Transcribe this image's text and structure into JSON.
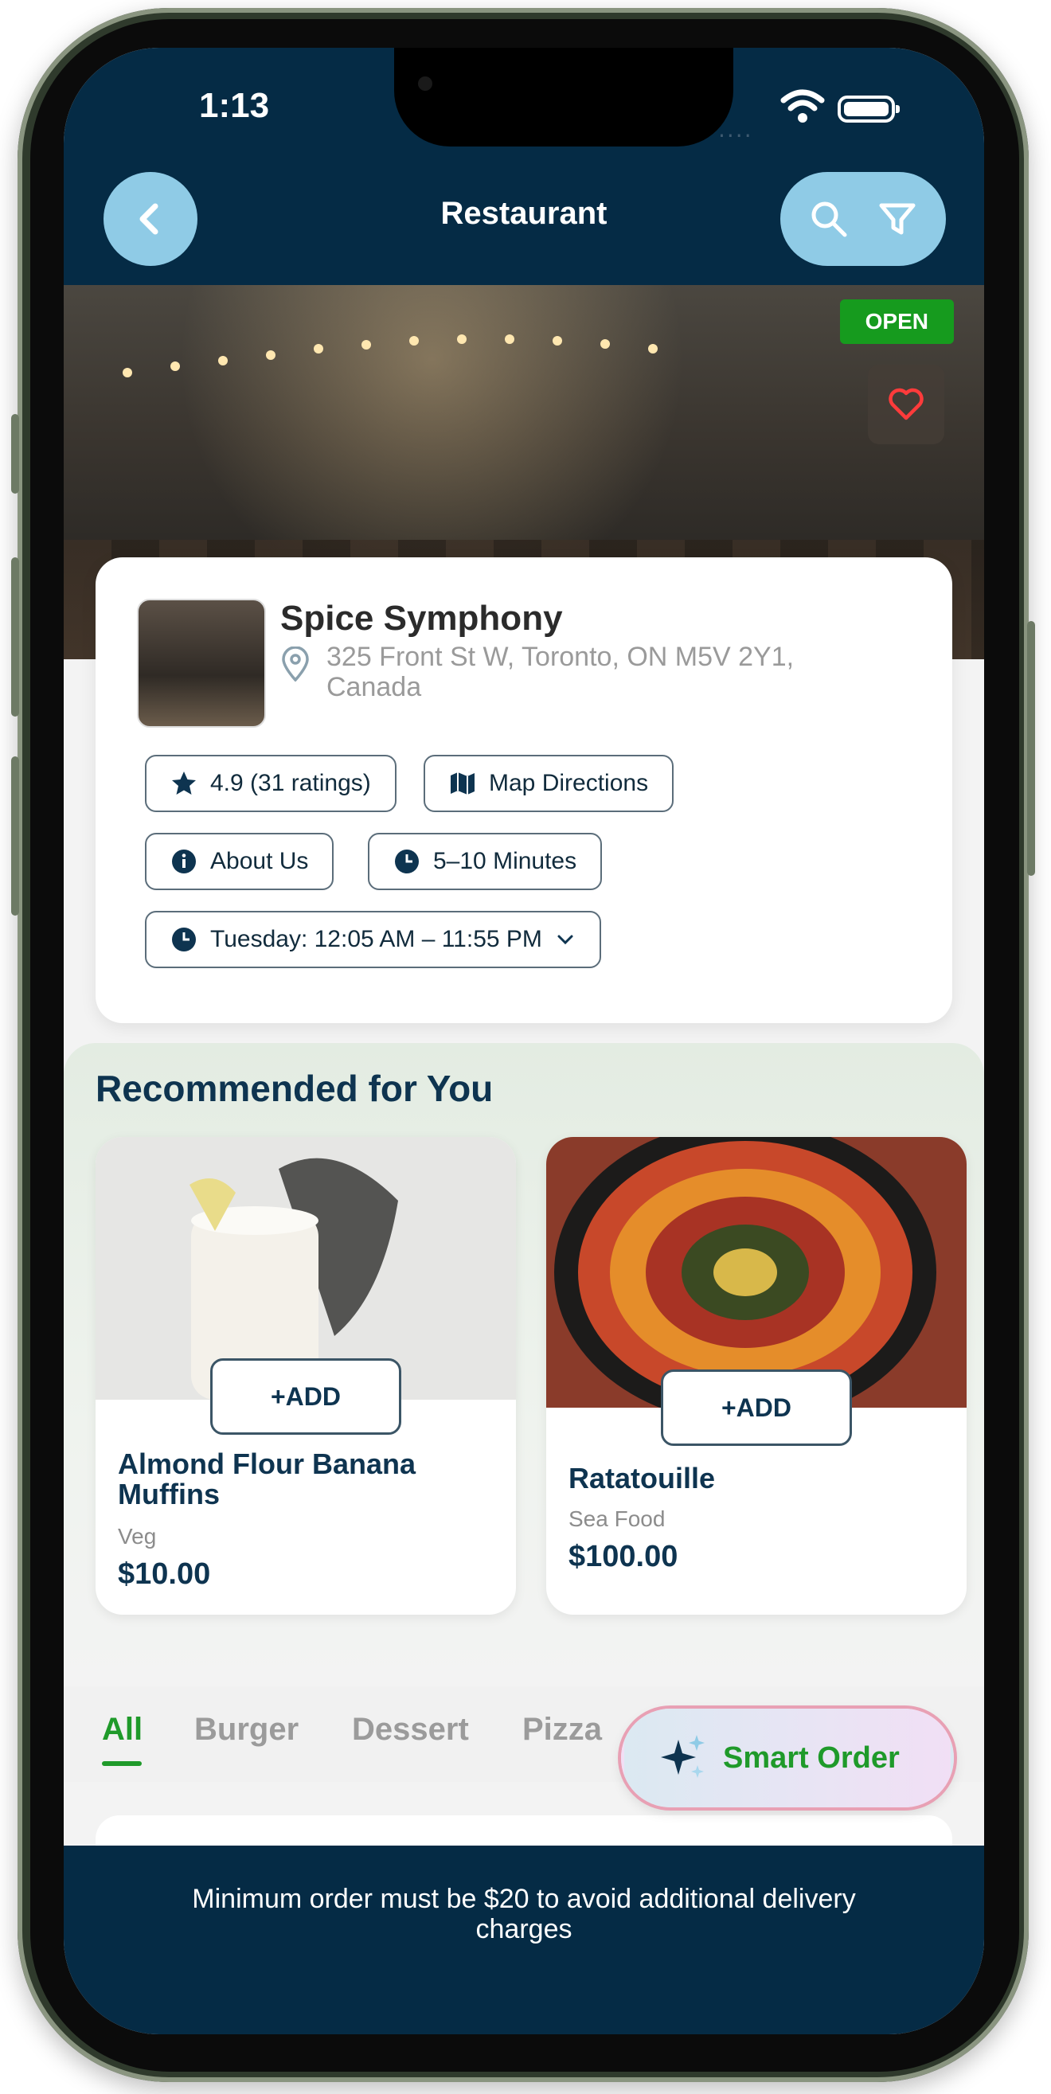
{
  "status_bar": {
    "time": "1:13",
    "signal": "....",
    "wifi_icon": "wifi-icon",
    "battery_icon": "battery-icon"
  },
  "header": {
    "title": "Restaurant",
    "back_icon": "chevron-left-icon",
    "search_icon": "search-icon",
    "filter_icon": "filter-icon"
  },
  "hero": {
    "status_badge": "OPEN",
    "favorite_icon": "heart-icon"
  },
  "restaurant": {
    "name": "Spice Symphony",
    "address": "325 Front St W, Toronto, ON M5V 2Y1, Canada",
    "chips": {
      "rating": "4.9 (31 ratings)",
      "map": "Map Directions",
      "about": "About Us",
      "delivery_time": "5–10 Minutes",
      "hours": "Tuesday: 12:05 AM – 11:55 PM"
    }
  },
  "recommended": {
    "title": "Recommended for You",
    "add_label": "+ADD",
    "items": [
      {
        "name": "Almond Flour Banana Muffins",
        "category": "Veg",
        "price": "$10.00"
      },
      {
        "name": "Ratatouille",
        "category": "Sea Food",
        "price": "$100.00"
      }
    ]
  },
  "category_tabs": [
    "All",
    "Burger",
    "Dessert",
    "Pizza"
  ],
  "active_tab": "All",
  "smart_order": {
    "label": "Smart Order",
    "icon": "sparkle-icon"
  },
  "banner": {
    "text": "Minimum order must be $20 to avoid additional delivery charges"
  },
  "colors": {
    "navy": "#052b45",
    "accent_blue": "#8fcbe6",
    "green": "#1f9a2a",
    "open_green": "#169b1e"
  }
}
